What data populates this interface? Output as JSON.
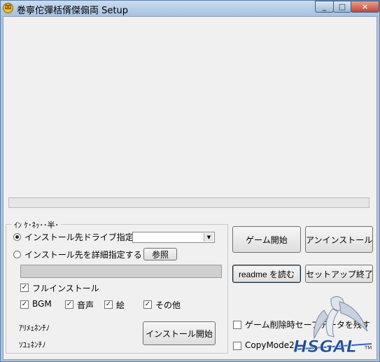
{
  "window": {
    "title": "巻寧佗彈栝偦傑傓両 Setup",
    "app_icon_glyph": "ﾛﾛ",
    "controls": {
      "minimize": "_",
      "maximize": "□",
      "close": "×"
    }
  },
  "progress": {
    "value": 0
  },
  "options_group": {
    "title": "ｲﾝ ｹ･ﾈｯ･･半･",
    "radio_drive_label": "インストール先ドライブ指定",
    "radio_drive_selected": true,
    "drive_select_value": "",
    "radio_detail_label": "インストール先を詳細指定する",
    "browse_button": "参照",
    "install_path_value": "",
    "full_install_label": "フルインストール",
    "full_install_checked": true,
    "components": [
      {
        "label": "BGM",
        "checked": true
      },
      {
        "label": "音声",
        "checked": true
      },
      {
        "label": "絵",
        "checked": true
      },
      {
        "label": "その他",
        "checked": true
      }
    ],
    "required_space_label": "ｱﾘﾒｪﾈﾝﾁﾉ",
    "free_space_label": "ｿﾕｭﾈﾝﾁﾉ",
    "install_start_button": "インストール開始"
  },
  "actions": {
    "game_start_button": "ゲーム開始",
    "uninstall_button": "アンインストール",
    "readme_button": "readme を読む",
    "setup_exit_button": "セットアップ終了",
    "keep_save_label": "ゲーム削除時セーブデータを残す",
    "keep_save_checked": false,
    "copymode_label": "CopyMode2",
    "copymode_checked": false
  },
  "branding": {
    "logo_text": "HSGAL",
    "logo_mark": "TM"
  },
  "colors": {
    "titlebar": "#a6c1df",
    "client_bg": "#f0f0f0",
    "close_button": "#c7432d",
    "logo_blue": "#1f4e9e"
  }
}
